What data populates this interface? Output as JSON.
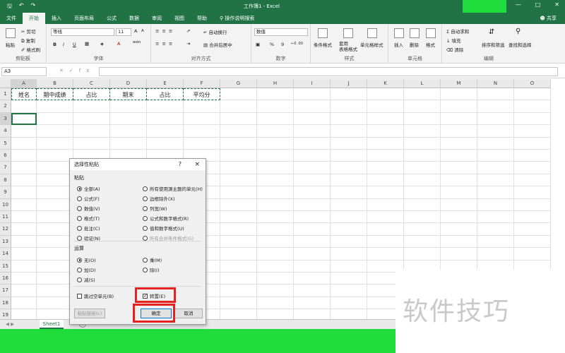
{
  "app": {
    "window_title": "工作簿1  -  Excel",
    "qat_icons": [
      "save-icon",
      "undo-icon",
      "redo-icon"
    ],
    "window_controls": [
      "minimize-icon",
      "maximize-icon",
      "close-icon"
    ],
    "share_label": "共享"
  },
  "menu": {
    "tabs": [
      "文件",
      "开始",
      "插入",
      "页面布局",
      "公式",
      "数据",
      "审阅",
      "视图",
      "帮助"
    ],
    "active_tab": "开始",
    "tell_me": "操作说明搜索"
  },
  "ribbon": {
    "clipboard": {
      "paste": "粘贴",
      "cut": "剪切",
      "copy": "复制",
      "format_painter": "格式刷",
      "label": "剪贴板"
    },
    "font": {
      "font_name": "等线",
      "font_size": "11",
      "bold": "B",
      "italic": "I",
      "underline": "U",
      "grow": "A",
      "shrink": "A",
      "label": "字体",
      "wen": "wén"
    },
    "alignment": {
      "wrap": "自动换行",
      "merge": "合并后居中",
      "label": "对齐方式"
    },
    "number": {
      "format": "数值",
      "percent": "%",
      "comma": "9",
      "label": "数字"
    },
    "styles": {
      "conditional": "条件格式",
      "table": "套用\n表格格式",
      "cell_styles": "单元格样式",
      "label": "样式"
    },
    "cells": {
      "insert": "插入",
      "delete": "删除",
      "format": "格式",
      "label": "单元格"
    },
    "editing": {
      "autosum": "自动求和",
      "fill": "填充",
      "clear": "清除",
      "sort": "排序和筛选",
      "find": "查找和选择",
      "label": "编辑"
    }
  },
  "formula_bar": {
    "name_box": "A3",
    "fx": "fx",
    "value": ""
  },
  "sheet": {
    "columns": [
      "A",
      "B",
      "C",
      "D",
      "E",
      "F",
      "G",
      "H",
      "I",
      "J",
      "K",
      "L",
      "M",
      "N",
      "O"
    ],
    "rows": [
      "1",
      "2",
      "3",
      "4",
      "5",
      "6",
      "7",
      "8",
      "9",
      "10",
      "11",
      "12",
      "13",
      "14",
      "15",
      "16",
      "17",
      "18",
      "19"
    ],
    "row1": [
      "姓名",
      "期中成绩",
      "占比",
      "期末",
      "占比",
      "平均分"
    ],
    "active_cell": "A3",
    "tab_name": "Sheet1"
  },
  "dialog": {
    "title": "选择性粘贴",
    "help": "?",
    "close": "×",
    "paste_section": "粘贴",
    "paste_left": [
      "全部(A)",
      "公式(F)",
      "数值(V)",
      "格式(T)",
      "批注(C)",
      "验证(N)"
    ],
    "paste_right": [
      "所有使用源主题的单元(H)",
      "边框除外(X)",
      "列宽(W)",
      "公式和数字格式(R)",
      "值和数字格式(U)",
      "所有合并条件格式(G)"
    ],
    "paste_selected": "全部(A)",
    "operation_section": "运算",
    "op_left": [
      "无(O)",
      "加(D)",
      "减(S)"
    ],
    "op_right": [
      "乘(M)",
      "除(I)"
    ],
    "op_selected": "无(O)",
    "skip_blanks": "跳过空单元(B)",
    "transpose": "转置(E)",
    "transpose_checked": true,
    "paste_link": "粘贴链接(L)",
    "ok": "确定",
    "cancel": "取消"
  },
  "watermark": "软件技巧",
  "colors": {
    "excel_green": "#217346",
    "highlight_red": "#e52222",
    "bright_green": "#1fdc3c"
  }
}
